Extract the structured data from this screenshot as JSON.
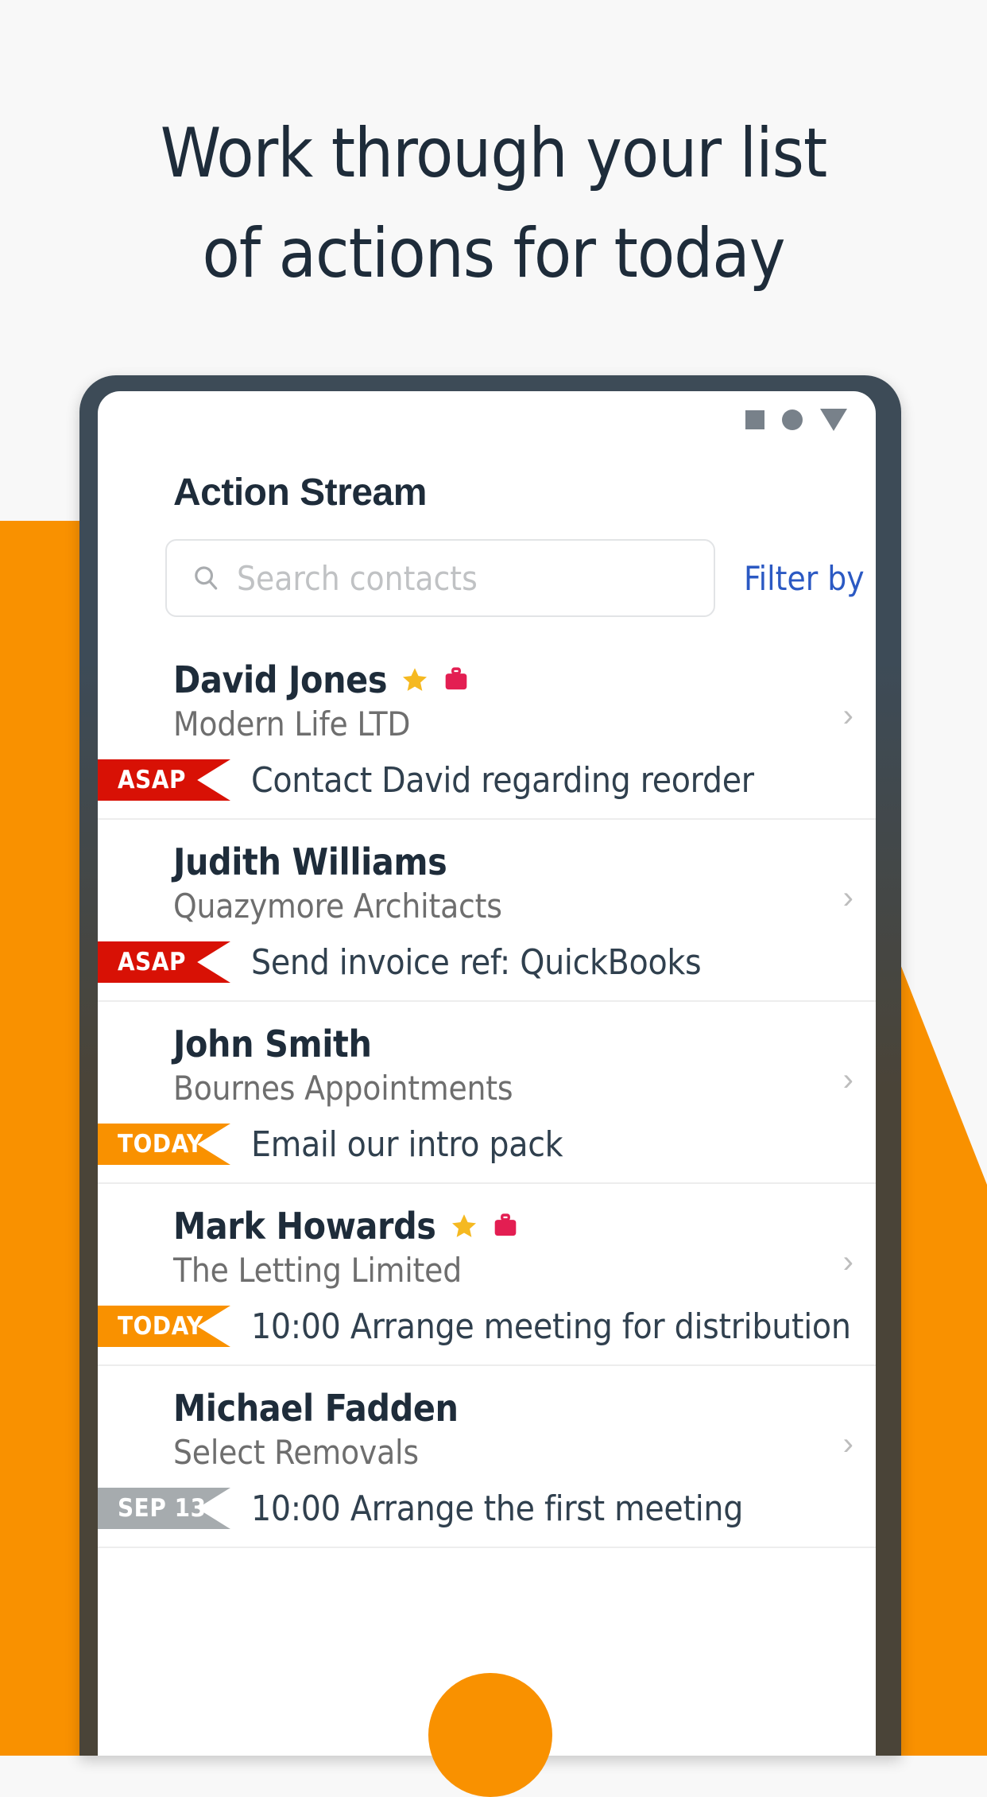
{
  "headline": {
    "line1": "Work through your list",
    "line2": "of actions for today",
    "color": "#1E2C3A"
  },
  "colors": {
    "orange": "#F99100",
    "red": "#D81105",
    "gray_badge": "#A6ABAE",
    "star": "#F5B921",
    "briefcase": "#E31E52",
    "link_blue": "#2B59C3",
    "page_bg": "#F8F8F8",
    "phone_bezel_top": "#3D4B57",
    "phone_bezel_bottom": "#4A4438"
  },
  "phone": {
    "statusbar": {
      "icons": [
        "square-icon",
        "circle-icon",
        "triangle-down-icon"
      ],
      "icon_color": "#78818A"
    },
    "app_title": "Action Stream",
    "search": {
      "icon": "search-icon",
      "placeholder": "Search contacts",
      "value": ""
    },
    "filter_label": "Filter by",
    "chevron": "›",
    "fab": {
      "name": "add-action-button",
      "color": "#F99100"
    },
    "rows": [
      {
        "name": "David Jones",
        "company": "Modern Life LTD",
        "starred": true,
        "business": true,
        "badge": {
          "label": "ASAP",
          "color": "#D81105"
        },
        "task": "Contact David regarding reorder"
      },
      {
        "name": "Judith Williams",
        "company": "Quazymore Architacts",
        "starred": false,
        "business": false,
        "badge": {
          "label": "ASAP",
          "color": "#D81105"
        },
        "task": "Send invoice ref: QuickBooks"
      },
      {
        "name": "John Smith",
        "company": "Bournes Appointments",
        "starred": false,
        "business": false,
        "badge": {
          "label": "TODAY",
          "color": "#F99100"
        },
        "task": "Email our intro pack"
      },
      {
        "name": "Mark Howards",
        "company": "The Letting Limited",
        "starred": true,
        "business": true,
        "badge": {
          "label": "TODAY",
          "color": "#F99100"
        },
        "task": "10:00 Arrange meeting for distribution"
      },
      {
        "name": "Michael Fadden",
        "company": "Select Removals",
        "starred": false,
        "business": false,
        "badge": {
          "label": "SEP 13",
          "color": "#A6ABAE"
        },
        "task": "10:00 Arrange the first meeting"
      }
    ]
  }
}
